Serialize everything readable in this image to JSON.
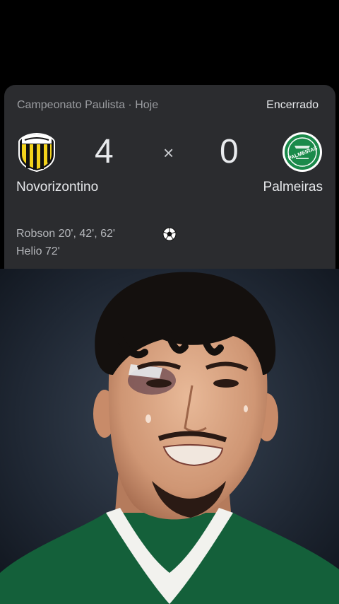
{
  "match": {
    "competition": "Campeonato Paulista · Hoje",
    "status": "Encerrado",
    "home": {
      "name": "Novorizontino",
      "score": "4",
      "crest_icon": "novorizontino-crest-icon"
    },
    "away": {
      "name": "Palmeiras",
      "score": "0",
      "crest_icon": "palmeiras-crest-icon"
    },
    "separator": "×",
    "scorers": [
      "Robson 20', 42', 62'",
      "Helio 72'"
    ]
  },
  "colors": {
    "card_bg": "#2b2c2f",
    "text_primary": "#e8eaed",
    "text_secondary": "#9a9ca0",
    "novorizontino_yellow": "#f2d21b",
    "palmeiras_green": "#1a8a4a"
  },
  "crest_text": {
    "away": "PALMEIRAS"
  }
}
